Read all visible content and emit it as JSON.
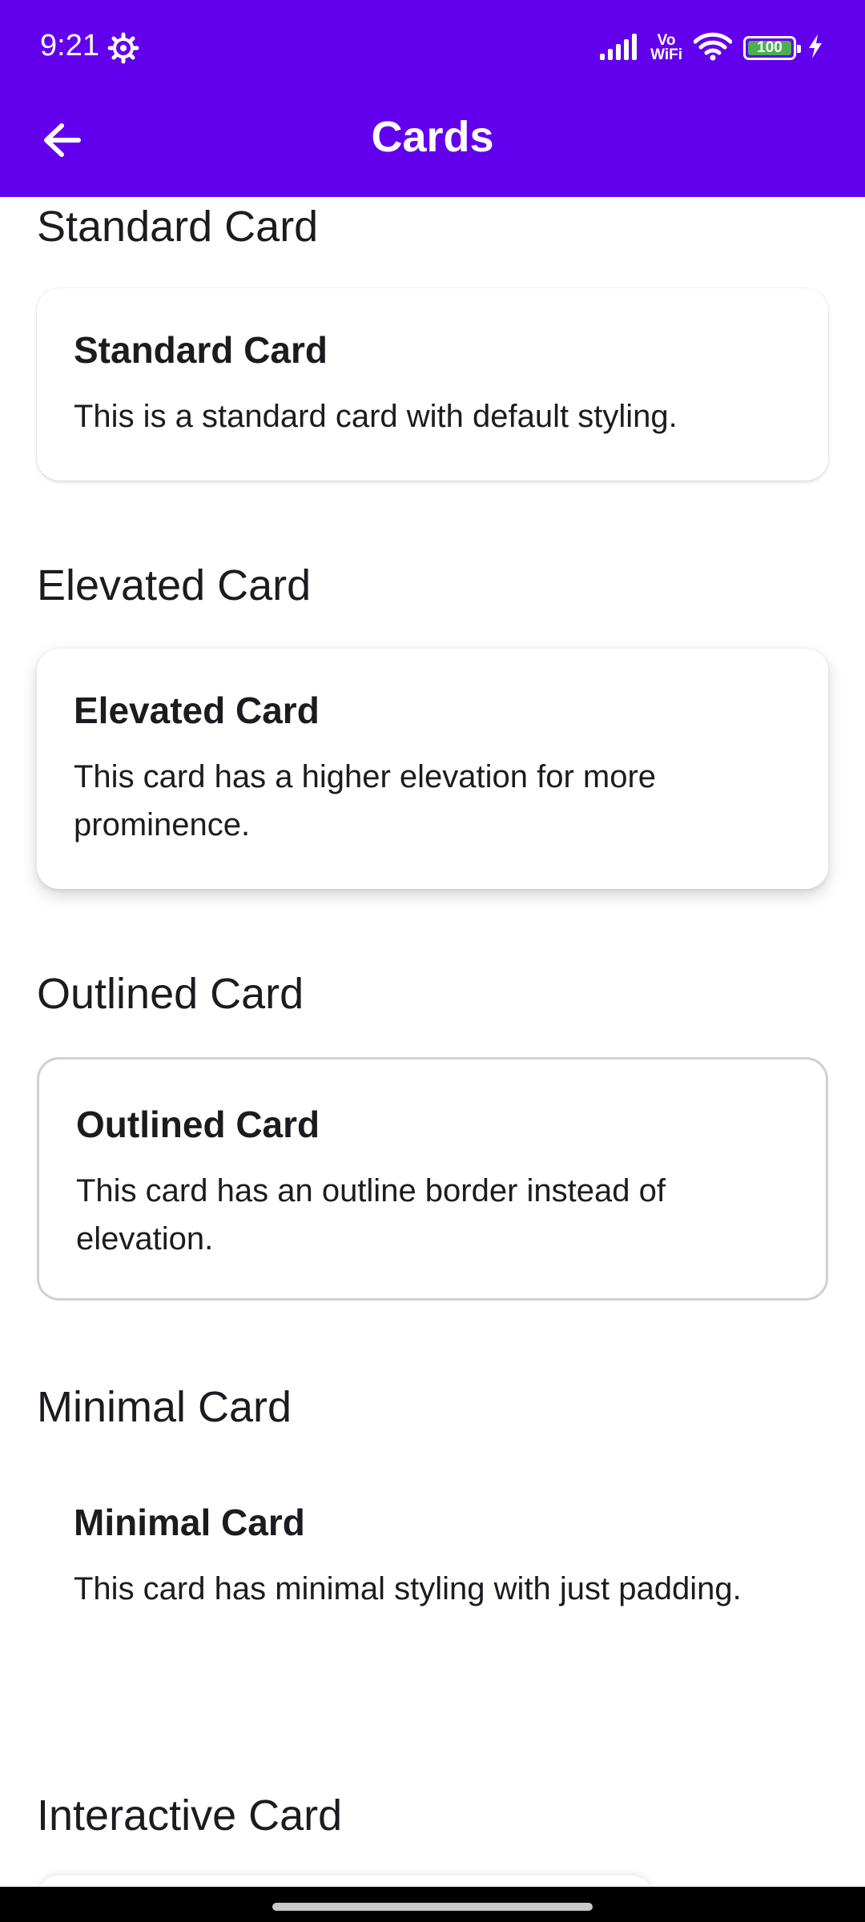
{
  "status_bar": {
    "time": "9:21",
    "vowifi_top": "Vo",
    "vowifi_bottom": "WiFi",
    "battery_level": "100"
  },
  "toolbar": {
    "title": "Cards"
  },
  "sections": {
    "standard": {
      "heading": "Standard Card",
      "card_title": "Standard Card",
      "card_body": "This is a standard card with default styling."
    },
    "elevated": {
      "heading": "Elevated Card",
      "card_title": "Elevated Card",
      "card_body": "This card has a higher elevation for more prominence."
    },
    "outlined": {
      "heading": "Outlined Card",
      "card_title": "Outlined Card",
      "card_body": "This card has an outline border instead of elevation."
    },
    "minimal": {
      "heading": "Minimal Card",
      "card_title": "Minimal Card",
      "card_body": "This card has minimal styling with just padding."
    },
    "interactive": {
      "heading": "Interactive Card"
    }
  },
  "colors": {
    "primary": "#6200ee",
    "text": "#1d1b20",
    "outline": "#d0d0d0",
    "battery": "#4caf50"
  },
  "icons": {
    "back": "arrow-back-icon",
    "settings": "gear-icon",
    "signal": "cellular-signal-icon",
    "wifi": "wifi-icon",
    "charging": "charging-bolt-icon"
  }
}
